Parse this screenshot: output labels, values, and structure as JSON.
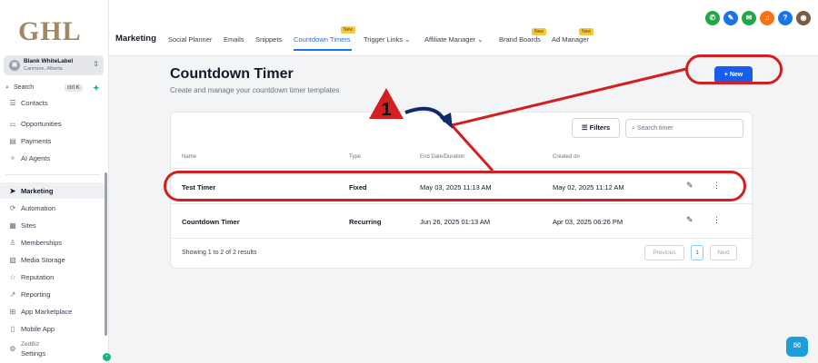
{
  "brand": {
    "logo": "GHL"
  },
  "account": {
    "name": "Blank WhiteLabel",
    "location": "Canmore, Alberta"
  },
  "sidebar": {
    "search_label": "Search",
    "search_shortcut": "ctrl K",
    "items": [
      {
        "label": "Contacts",
        "icon": "contacts-icon"
      },
      {
        "label": "Opportunities",
        "icon": "opportunities-icon"
      },
      {
        "label": "Payments",
        "icon": "payments-icon"
      },
      {
        "label": "AI Agents",
        "icon": "ai-agents-icon"
      },
      {
        "label": "Marketing",
        "icon": "send-icon",
        "active": true
      },
      {
        "label": "Automation",
        "icon": "automation-icon"
      },
      {
        "label": "Sites",
        "icon": "sites-icon"
      },
      {
        "label": "Memberships",
        "icon": "memberships-icon"
      },
      {
        "label": "Media Storage",
        "icon": "media-icon"
      },
      {
        "label": "Reputation",
        "icon": "star-icon"
      },
      {
        "label": "Reporting",
        "icon": "reporting-icon"
      },
      {
        "label": "App Marketplace",
        "icon": "grid-icon"
      },
      {
        "label": "Mobile App",
        "icon": "mobile-icon"
      }
    ],
    "settings_org": "ZedBiz",
    "settings_label": "Settings"
  },
  "topbar": {
    "section": "Marketing",
    "tabs": [
      {
        "label": "Social Planner"
      },
      {
        "label": "Emails"
      },
      {
        "label": "Snippets"
      },
      {
        "label": "Countdown Timers",
        "active": true,
        "badge": "New"
      },
      {
        "label": "Trigger Links",
        "dropdown": true
      },
      {
        "label": "Affiliate Manager",
        "dropdown": true
      },
      {
        "label": "Brand Boards",
        "badge": "New"
      },
      {
        "label": "Ad Manager",
        "badge": "New"
      }
    ],
    "icon_colors": [
      "#22a447",
      "#1a73e8",
      "#22a447",
      "#f97316",
      "#1a73e8"
    ]
  },
  "page": {
    "title": "Countdown Timer",
    "subtitle": "Create and manage your countdown timer templates",
    "new_button": "+ New"
  },
  "toolbar": {
    "filters_label": "Filters",
    "search_placeholder": "Search timer"
  },
  "table": {
    "headers": [
      "Name",
      "Type",
      "End Date/Duration",
      "Created on"
    ],
    "rows": [
      {
        "name": "Test Timer",
        "type": "Fixed",
        "end": "May 03, 2025 11:13 AM",
        "created": "May 02, 2025 11:12 AM"
      },
      {
        "name": "Countdown Timer",
        "type": "Recurring",
        "end": "Jun 26, 2025 01:13 AM",
        "created": "Apr 03, 2025 06:26 PM"
      }
    ],
    "footer": "Showing 1 to 2 of 2 results"
  },
  "pagination": {
    "previous": "Previous",
    "current": "1",
    "next": "Next"
  },
  "annotation": {
    "step_number": "1",
    "color": "#d21f1f",
    "arrow_color": "#0f2a6b"
  }
}
